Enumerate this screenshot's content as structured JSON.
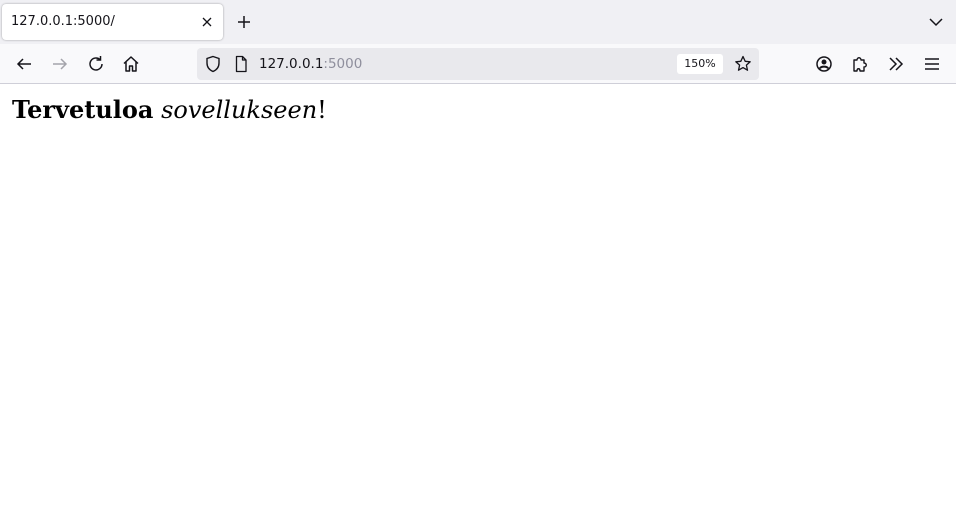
{
  "browser": {
    "tab": {
      "title": "127.0.0.1:5000/",
      "close_icon": "close-icon"
    },
    "new_tab_icon": "plus-icon",
    "tab_list_icon": "chevron-down-icon",
    "nav": {
      "back_icon": "arrow-left-icon",
      "forward_icon": "arrow-right-icon",
      "reload_icon": "reload-icon",
      "home_icon": "home-icon"
    },
    "url": {
      "host": "127.0.0.1",
      "port": ":5000",
      "zoom": "150%",
      "shield_icon": "shield-icon",
      "page_icon": "page-icon",
      "bookmark_icon": "star-icon"
    },
    "toolbar": {
      "account_icon": "account-icon",
      "extensions_icon": "puzzle-icon",
      "overflow_icon": "double-chevron-icon",
      "menu_icon": "hamburger-icon"
    },
    "colors": {
      "tabbar_bg": "#f0f0f4",
      "navbar_bg": "#f9f9fb",
      "urlbar_bg": "#e9e9ed"
    }
  },
  "page": {
    "heading_bold": "Tervetuloa",
    "heading_italic": "sovellukseen",
    "heading_end": "!"
  }
}
